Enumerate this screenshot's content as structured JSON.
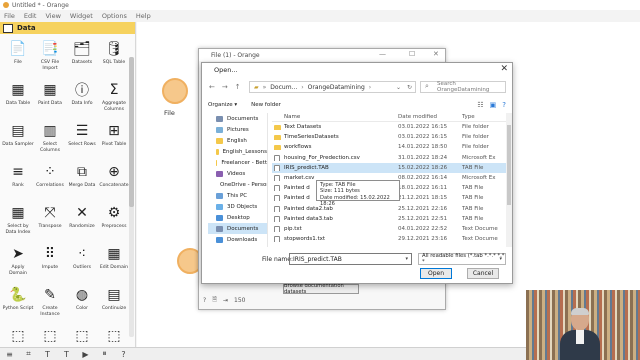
{
  "window": {
    "title": "Untitled * - Orange"
  },
  "menu": [
    "File",
    "Edit",
    "View",
    "Widget",
    "Options",
    "Help"
  ],
  "sidebar": {
    "category": "Data",
    "widgets": [
      {
        "label": "File",
        "icon": "📄"
      },
      {
        "label": "CSV File Import",
        "icon": "📑"
      },
      {
        "label": "Datasets",
        "icon": "🗂"
      },
      {
        "label": "SQL Table",
        "icon": "🛢"
      },
      {
        "label": "Data Table",
        "icon": "▦"
      },
      {
        "label": "Paint Data",
        "icon": "▦"
      },
      {
        "label": "Data Info",
        "icon": "ⓘ"
      },
      {
        "label": "Aggregate Columns",
        "icon": "Σ"
      },
      {
        "label": "Data Sampler",
        "icon": "▤"
      },
      {
        "label": "Select Columns",
        "icon": "▥"
      },
      {
        "label": "Select Rows",
        "icon": "☰"
      },
      {
        "label": "Pivot Table",
        "icon": "⊞"
      },
      {
        "label": "Rank",
        "icon": "≡"
      },
      {
        "label": "Correlations",
        "icon": "⁘"
      },
      {
        "label": "Merge Data",
        "icon": "⧉"
      },
      {
        "label": "Concatenate",
        "icon": "⊕"
      },
      {
        "label": "Select by Data Index",
        "icon": "▦"
      },
      {
        "label": "Transpose",
        "icon": "⤧"
      },
      {
        "label": "Randomize",
        "icon": "✕"
      },
      {
        "label": "Preprocess",
        "icon": "⚙"
      },
      {
        "label": "Apply Domain",
        "icon": "➤"
      },
      {
        "label": "Impute",
        "icon": "⠿"
      },
      {
        "label": "Outliers",
        "icon": "⁖"
      },
      {
        "label": "Edit Domain",
        "icon": "▦"
      },
      {
        "label": "Python Script",
        "icon": "🐍"
      },
      {
        "label": "Create Instance",
        "icon": "✎"
      },
      {
        "label": "Color",
        "icon": "◍"
      },
      {
        "label": "Continuize",
        "icon": "▤"
      },
      {
        "label": "",
        "icon": "⬚"
      },
      {
        "label": "",
        "icon": "⬚"
      },
      {
        "label": "",
        "icon": "⬚"
      },
      {
        "label": "",
        "icon": "⬚"
      }
    ]
  },
  "canvas": {
    "node_label": "File"
  },
  "bottom_toolbar": [
    "≡",
    "⌗",
    "T",
    "T",
    "▶",
    "⏸",
    "?"
  ],
  "file_window": {
    "title": "File (1) - Orange",
    "status_count": "150",
    "browse_label": "Browse documentation datasets"
  },
  "open_dialog": {
    "title": "Open...",
    "address": [
      "Docum...",
      "OrangeDatamining"
    ],
    "search_placeholder": "Search OrangeDatamining",
    "organize": "Organize ▾",
    "new_folder": "New folder",
    "nav_items": [
      {
        "label": "Documents",
        "color": "#7a8fb0"
      },
      {
        "label": "Pictures",
        "color": "#7ab0d8"
      },
      {
        "label": "English",
        "color": "#f4c84a"
      },
      {
        "label": "English_Lessons",
        "color": "#f4c84a"
      },
      {
        "label": "Freelancer - Bett",
        "color": "#f4c84a"
      },
      {
        "label": "Videos",
        "color": "#8a5fb0"
      },
      {
        "label": "OneDrive - Person",
        "color": "#2a7ad8"
      },
      {
        "label": "This PC",
        "color": "#6aa0d8"
      },
      {
        "label": "3D Objects",
        "color": "#6ab0e8"
      },
      {
        "label": "Desktop",
        "color": "#4a90d8"
      },
      {
        "label": "Documents",
        "color": "#7a8fb0"
      },
      {
        "label": "Downloads",
        "color": "#4a90d8"
      }
    ],
    "columns": [
      "Name",
      "Date modified",
      "Type"
    ],
    "files": [
      {
        "name": "Text Datasets",
        "date": "03.01.2022 16:15",
        "type": "File folder",
        "kind": "folder"
      },
      {
        "name": "TimeSeriesDatasets",
        "date": "03.01.2022 16:15",
        "type": "File folder",
        "kind": "folder"
      },
      {
        "name": "workflows",
        "date": "14.01.2022 18:50",
        "type": "File folder",
        "kind": "folder"
      },
      {
        "name": "housing_For_Predection.csv",
        "date": "31.01.2022 18:24",
        "type": "Microsoft Ex",
        "kind": "doc"
      },
      {
        "name": "IRIS_predict.TAB",
        "date": "15.02.2022 18:26",
        "type": "TAB File",
        "kind": "doc"
      },
      {
        "name": "market.csv",
        "date": "08.02.2022 16:14",
        "type": "Microsoft Ex",
        "kind": "doc"
      },
      {
        "name": "Painted d",
        "date": "18.01.2022 16:11",
        "type": "TAB File",
        "kind": "doc"
      },
      {
        "name": "Painted d",
        "date": "21.12.2021 18:15",
        "type": "TAB File",
        "kind": "doc"
      },
      {
        "name": "Painted data2.tab",
        "date": "25.12.2021 22:16",
        "type": "TAB File",
        "kind": "doc"
      },
      {
        "name": "Painted data3.tab",
        "date": "25.12.2021 22:51",
        "type": "TAB File",
        "kind": "doc"
      },
      {
        "name": "pip.txt",
        "date": "04.01.2022 22:52",
        "type": "Text Docume",
        "kind": "doc"
      },
      {
        "name": "stopwords1.txt",
        "date": "29.12.2021 23:16",
        "type": "Text Docume",
        "kind": "doc"
      }
    ],
    "selected_index": 4,
    "tooltip": [
      "Type: TAB File",
      "Size: 111 bytes",
      "Date modified: 15.02.2022 18:26"
    ],
    "filename_label": "File name:",
    "filename_value": "IRIS_predict.TAB",
    "filetype_value": "All readable files (*.tab *.*.* *.* *",
    "open_label": "Open",
    "cancel_label": "Cancel"
  },
  "colors": {
    "category_yellow": "#f6d25e",
    "selection_blue": "#cce4f7",
    "node_orange": "#f6c88b"
  }
}
